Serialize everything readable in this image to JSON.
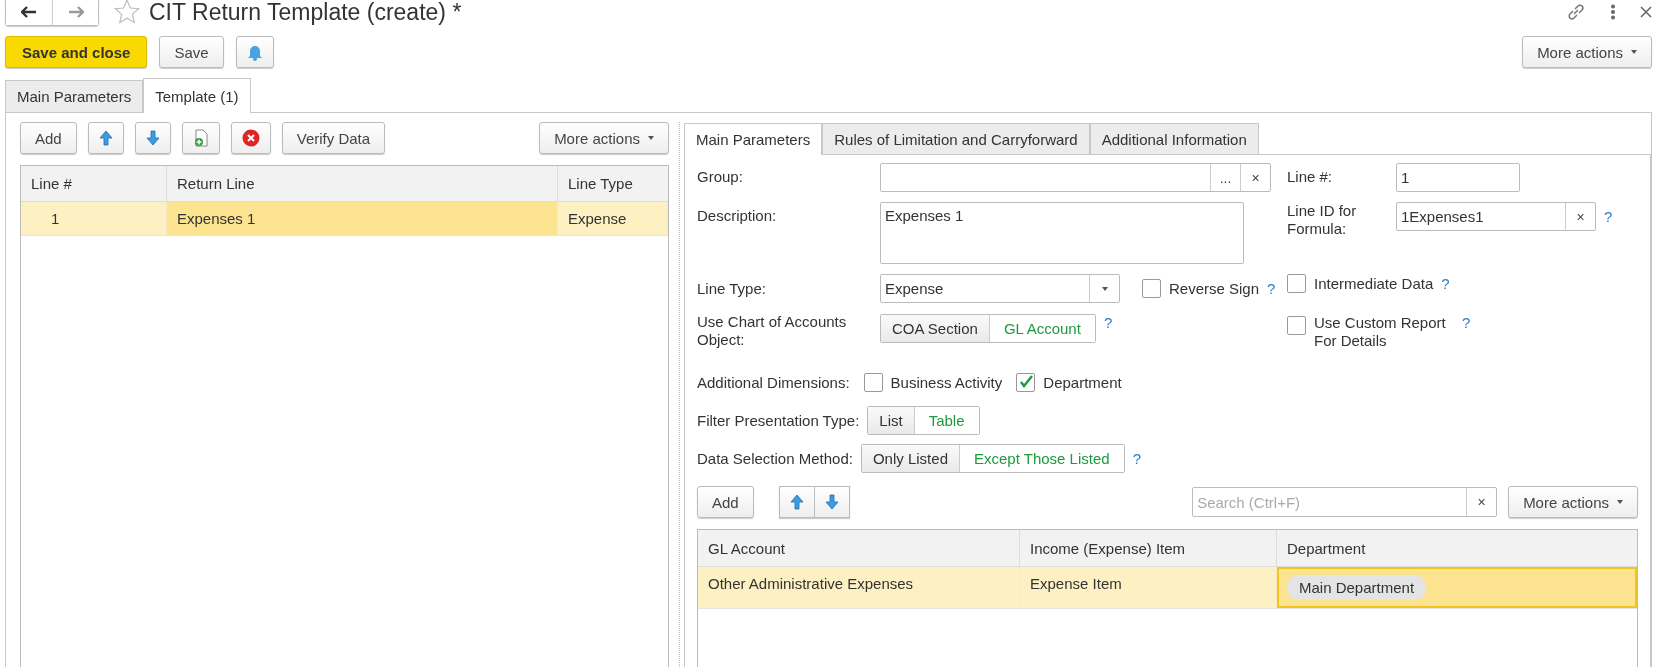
{
  "window": {
    "title": "CIT Return Template (create) *",
    "starred": false
  },
  "toolbar": {
    "buttons": [
      {
        "kind": "primary",
        "label": "Save and close"
      },
      {
        "kind": "normal",
        "label": "Save"
      },
      {
        "kind": "bell"
      }
    ],
    "more_actions": "More actions"
  },
  "tabs": [
    {
      "label": "Main Parameters",
      "selected": false
    },
    {
      "label": "Template (1)",
      "selected": true
    }
  ],
  "lines_panel": {
    "add": "Add",
    "verify": "Verify Data",
    "more_actions": "More actions",
    "columns": [
      "Line #",
      "Return Line",
      "Line Type"
    ],
    "rows": [
      {
        "cells": [
          "1",
          "Expenses 1",
          "Expense"
        ],
        "selected": true
      }
    ]
  },
  "detail": {
    "tabs": [
      {
        "label": "Main Parameters",
        "selected": true
      },
      {
        "label": "Rules of Limitation and Carryforward",
        "selected": false
      },
      {
        "label": "Additional Information",
        "selected": false
      }
    ],
    "group": {
      "label": "Group:",
      "choice": "...",
      "clear": "×"
    },
    "line_no": {
      "label": "Line #:",
      "value": "1"
    },
    "description": {
      "label": "Description:",
      "value": "Expenses 1"
    },
    "line_id": {
      "label": "Line ID for Formula:",
      "value": "1Expenses1",
      "clear": "×",
      "help": "?"
    },
    "line_type": {
      "label": "Line Type:",
      "value": "Expense"
    },
    "reverse_sign": {
      "label": "Reverse Sign",
      "checked": false,
      "help": "?"
    },
    "intermediate_data": {
      "label": "Intermediate Data",
      "checked": false,
      "help": "?"
    },
    "coa_object": {
      "label": "Use Chart of Accounts Object:",
      "help": "?",
      "options": [
        {
          "label": "COA Section",
          "selected": false
        },
        {
          "label": "GL Account",
          "selected": true
        }
      ]
    },
    "custom_report": {
      "label": "Use Custom Report For Details",
      "checked": false,
      "help": "?"
    },
    "dimensions": {
      "label": "Additional Dimensions:",
      "items": [
        {
          "label": "Business Activity",
          "checked": false
        },
        {
          "label": "Department",
          "checked": true
        }
      ]
    },
    "filter_type": {
      "label": "Filter Presentation Type:",
      "options": [
        {
          "label": "List",
          "selected": false
        },
        {
          "label": "Table",
          "selected": true
        }
      ]
    },
    "selection_method": {
      "label": "Data Selection Method:",
      "help": "?",
      "options": [
        {
          "label": "Only Listed",
          "selected": false
        },
        {
          "label": "Except Those Listed",
          "selected": true
        }
      ]
    },
    "filters": {
      "add": "Add",
      "search_placeholder": "Search (Ctrl+F)",
      "search_clear": "×",
      "more_actions": "More actions",
      "columns": [
        "GL Account",
        "Income (Expense) Item",
        "Department"
      ],
      "rows": [
        {
          "cells": [
            "Other Administrative Expenses",
            "Expense Item",
            "Main Department"
          ],
          "selected": true
        }
      ]
    }
  }
}
